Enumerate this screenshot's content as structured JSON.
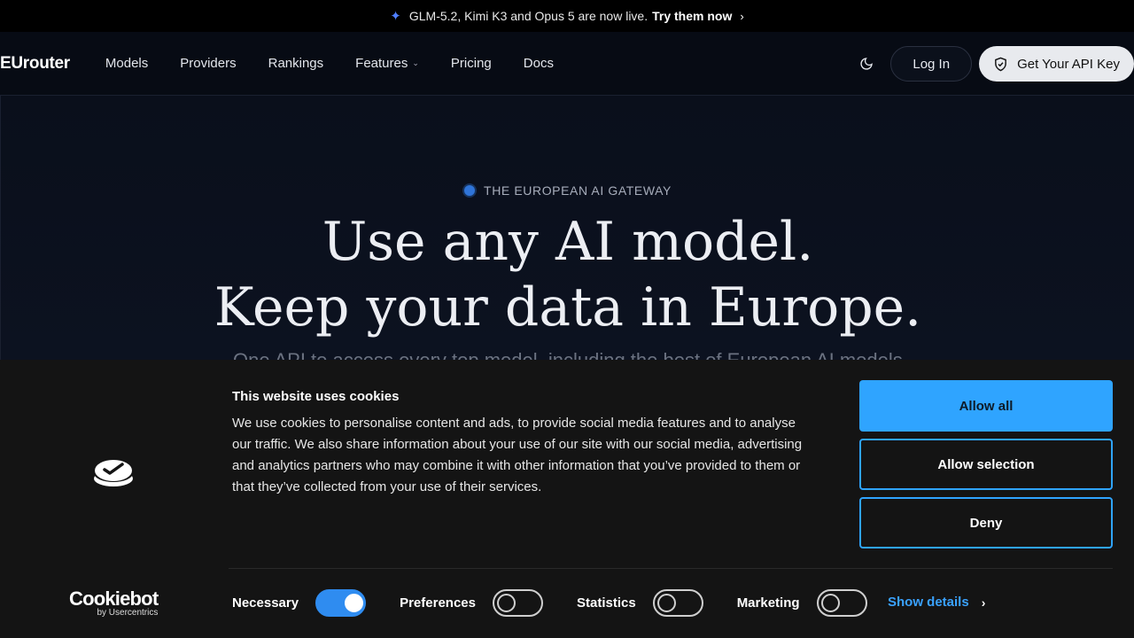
{
  "announcement": {
    "icon": "sparkle-icon",
    "text": "GLM-5.2, Kimi K3 and Opus 5 are now live.",
    "cta": "Try them now"
  },
  "nav": {
    "logo": "EUrouter",
    "links": [
      "Models",
      "Providers",
      "Rankings",
      "Features",
      "Pricing",
      "Docs"
    ],
    "login_label": "Log In",
    "api_key_label": "Get Your API Key"
  },
  "hero": {
    "eyebrow": "THE EUROPEAN AI GATEWAY",
    "headline_line1": "Use any AI model.",
    "headline_line2": "Keep your data in Europe.",
    "subtitle": "One API to access every top model, including the best of European AI models."
  },
  "cookie_banner": {
    "title": "This website uses cookies",
    "body": "We use cookies to personalise content and ads, to provide social media features and to analyse our traffic. We also share information about your use of our site with our social media, advertising and analytics partners who may combine it with other information that you’ve provided to them or that they’ve collected from your use of their services.",
    "allow_all": "Allow all",
    "allow_selection": "Allow selection",
    "deny": "Deny",
    "brand": "Cookiebot",
    "brand_by": "by Usercentrics",
    "toggles": [
      {
        "label": "Necessary",
        "on": true
      },
      {
        "label": "Preferences",
        "on": false
      },
      {
        "label": "Statistics",
        "on": false
      },
      {
        "label": "Marketing",
        "on": false
      }
    ],
    "show_details": "Show details"
  },
  "colors": {
    "accent": "#2fa4ff",
    "background": "#070b14",
    "banner": "#141414"
  }
}
